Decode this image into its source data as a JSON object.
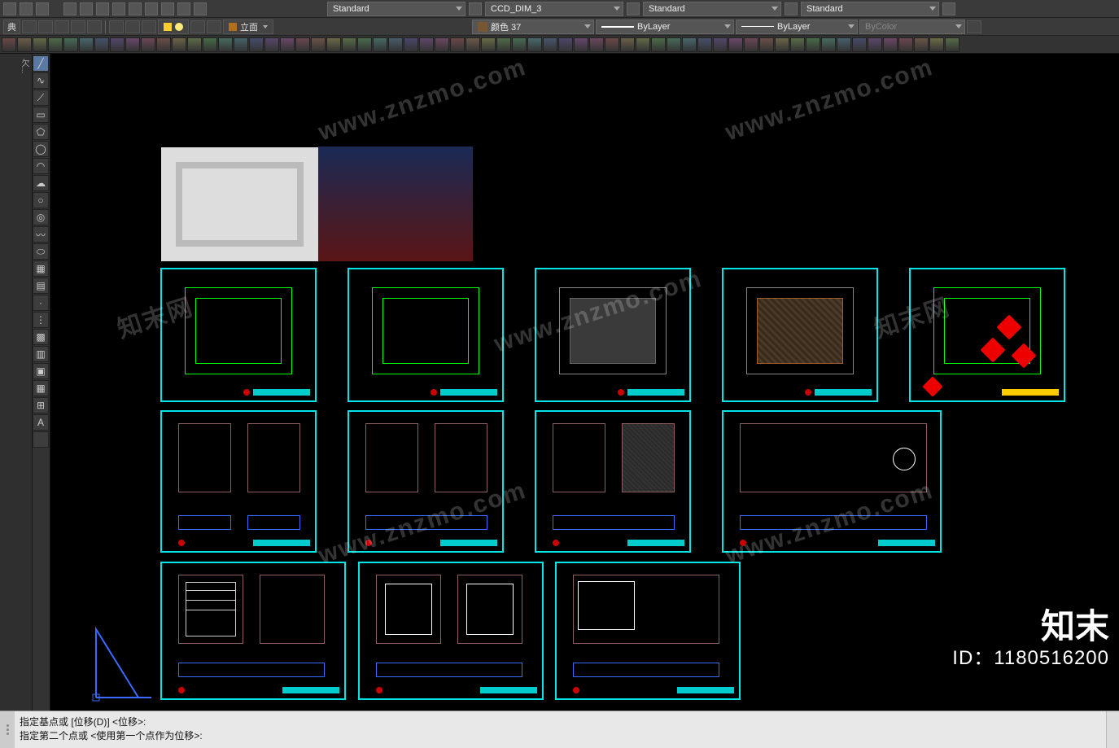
{
  "top_dropdowns": {
    "style1": "Standard",
    "dimstyle": "CCD_DIM_3",
    "style2": "Standard",
    "style3": "Standard",
    "color_label": "颜色 37",
    "layer": "ByLayer",
    "ltype": "ByLayer",
    "plotstyle": "ByColor"
  },
  "ribbon": {
    "left_label": "典",
    "elev_button": "立面"
  },
  "left_panel": {
    "tab": "欠..."
  },
  "tool_col": {
    "items": [
      {
        "name": "line-tool",
        "glyph": "╱"
      },
      {
        "name": "polyline-tool",
        "glyph": "∿"
      },
      {
        "name": "xline-tool",
        "glyph": "⟋"
      },
      {
        "name": "rect-tool",
        "glyph": "▭"
      },
      {
        "name": "polygon-tool",
        "glyph": "⬠"
      },
      {
        "name": "ellipse-tool",
        "glyph": "◯"
      },
      {
        "name": "arc-tool",
        "glyph": "◠"
      },
      {
        "name": "revcloud-tool",
        "glyph": "☁"
      },
      {
        "name": "circle-tool",
        "glyph": "○"
      },
      {
        "name": "donut-tool",
        "glyph": "◎"
      },
      {
        "name": "spline-tool",
        "glyph": "〰"
      },
      {
        "name": "ellipse2-tool",
        "glyph": "⬭"
      },
      {
        "name": "hatch-bound-tool",
        "glyph": "▦"
      },
      {
        "name": "region-tool",
        "glyph": "▤"
      },
      {
        "name": "point-tool",
        "glyph": "·"
      },
      {
        "name": "divide-tool",
        "glyph": "⋮"
      },
      {
        "name": "hatch-tool",
        "glyph": "▩"
      },
      {
        "name": "gradient-tool",
        "glyph": "▥"
      },
      {
        "name": "block-tool",
        "glyph": "▣"
      },
      {
        "name": "table-tool",
        "glyph": "▦"
      },
      {
        "name": "grid-tool",
        "glyph": "⊞"
      },
      {
        "name": "text-tool",
        "glyph": "A"
      },
      {
        "name": "sep-tool",
        "glyph": ""
      }
    ]
  },
  "command": {
    "line1": "指定基点或  [位移(D)]  <位移>:",
    "line2": "指定第二个点或  <使用第一个点作为位移>:"
  },
  "watermark": {
    "url": "www.znzmo.com",
    "brand_cn": "知末网",
    "brand": "知末",
    "id": "ID：1180516200"
  }
}
